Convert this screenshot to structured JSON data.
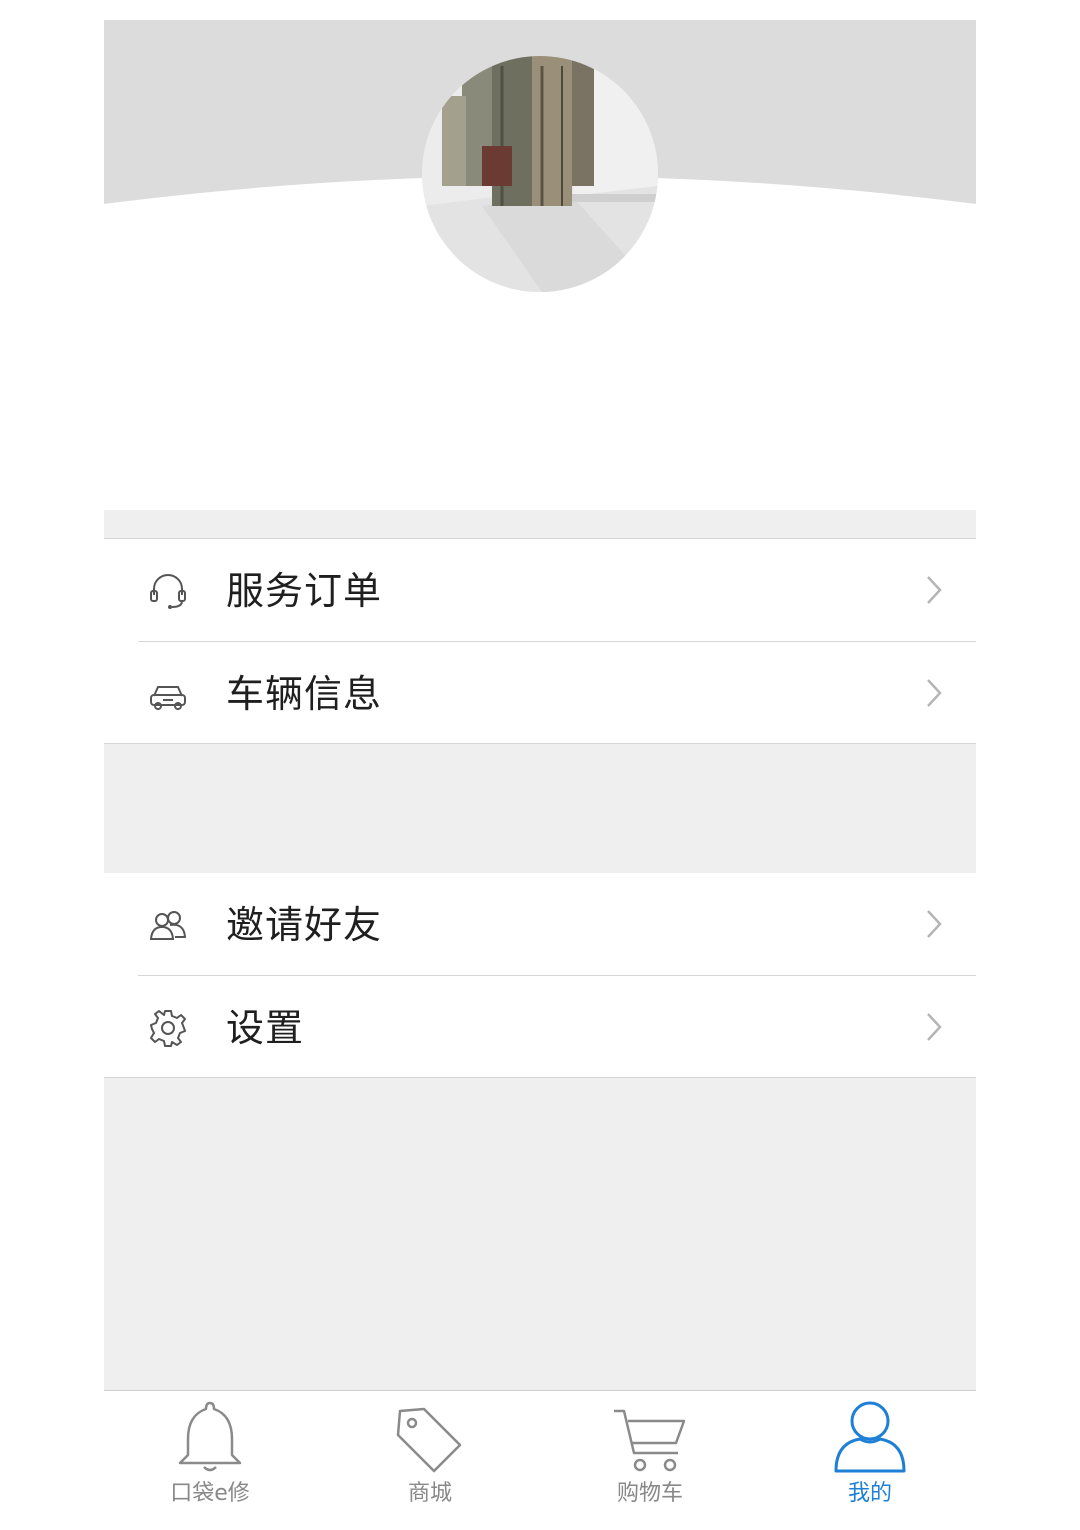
{
  "menu": {
    "group1": [
      {
        "label": "服务订单",
        "icon": "headset-icon"
      },
      {
        "label": "车辆信息",
        "icon": "car-icon"
      }
    ],
    "group2": [
      {
        "label": "邀请好友",
        "icon": "users-icon"
      },
      {
        "label": "设置",
        "icon": "gear-icon"
      }
    ]
  },
  "tabbar": {
    "items": [
      {
        "label": "口袋e修",
        "icon": "bell-icon",
        "active": false
      },
      {
        "label": "商城",
        "icon": "tag-icon",
        "active": false
      },
      {
        "label": "购物车",
        "icon": "cart-icon",
        "active": false
      },
      {
        "label": "我的",
        "icon": "person-icon",
        "active": true
      }
    ]
  },
  "colors": {
    "header_bg": "#dcdcdc",
    "page_bg": "#efeff0",
    "active_tab": "#1d7fd6",
    "inactive_tab": "#888888",
    "text": "#1f1f1f"
  }
}
